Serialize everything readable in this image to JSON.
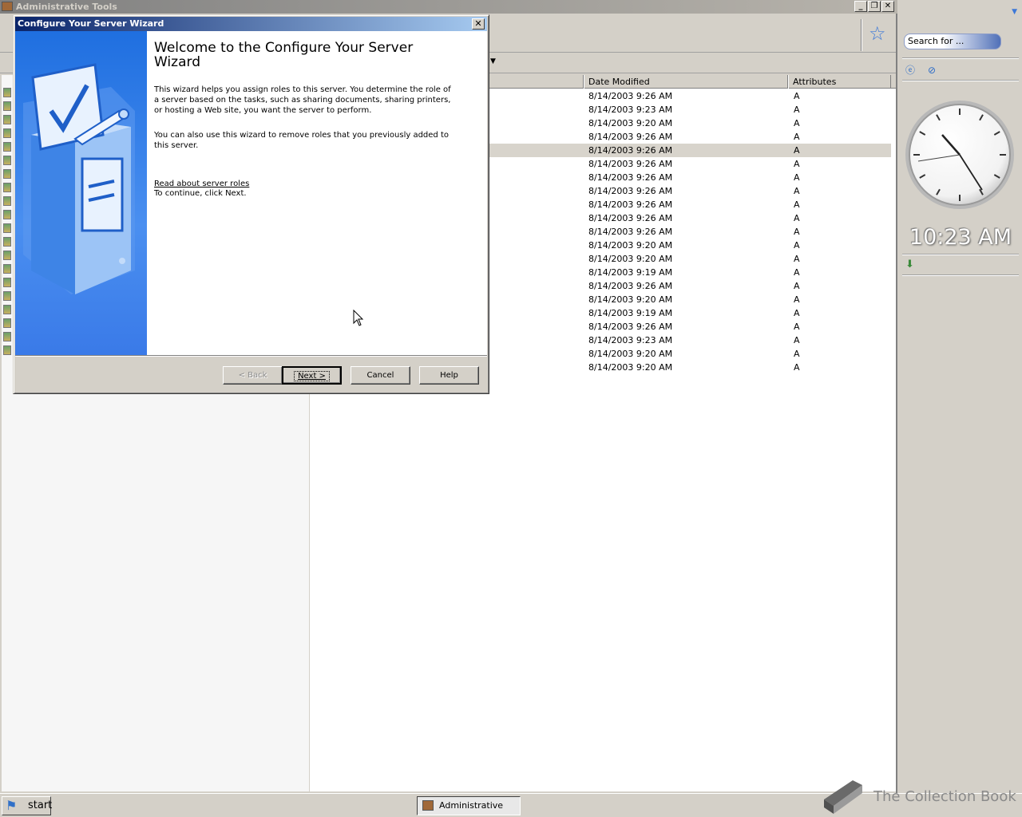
{
  "explorer": {
    "title": "Administrative Tools",
    "columns": {
      "date_modified": "Date Modified",
      "attributes": "Attributes"
    },
    "rows": [
      {
        "date": "8/14/2003 9:26 AM",
        "attr": "A"
      },
      {
        "date": "8/14/2003 9:23 AM",
        "attr": "A"
      },
      {
        "date": "8/14/2003 9:20 AM",
        "attr": "A"
      },
      {
        "date": "8/14/2003 9:26 AM",
        "attr": "A"
      },
      {
        "date": "8/14/2003 9:26 AM",
        "attr": "A",
        "selected": true
      },
      {
        "date": "8/14/2003 9:26 AM",
        "attr": "A"
      },
      {
        "date": "8/14/2003 9:26 AM",
        "attr": "A"
      },
      {
        "date": "8/14/2003 9:26 AM",
        "attr": "A"
      },
      {
        "date": "8/14/2003 9:26 AM",
        "attr": "A"
      },
      {
        "date": "8/14/2003 9:26 AM",
        "attr": "A"
      },
      {
        "date": "8/14/2003 9:26 AM",
        "attr": "A"
      },
      {
        "date": "8/14/2003 9:20 AM",
        "attr": "A"
      },
      {
        "date": "8/14/2003 9:20 AM",
        "attr": "A"
      },
      {
        "date": "8/14/2003 9:19 AM",
        "attr": "A"
      },
      {
        "date": "8/14/2003 9:26 AM",
        "attr": "A"
      },
      {
        "date": "8/14/2003 9:20 AM",
        "attr": "A"
      },
      {
        "date": "8/14/2003 9:19 AM",
        "attr": "A"
      },
      {
        "date": "8/14/2003 9:26 AM",
        "attr": "A"
      },
      {
        "date": "8/14/2003 9:23 AM",
        "attr": "A"
      },
      {
        "date": "8/14/2003 9:20 AM",
        "attr": "A"
      },
      {
        "date": "8/14/2003 9:20 AM",
        "attr": "A"
      }
    ]
  },
  "wizard": {
    "window_title": "Configure Your Server Wizard",
    "heading": "Welcome to the Configure Your Server Wizard",
    "paragraph1": "This wizard helps you assign roles to this server. You determine the role of a server based on the tasks, such as sharing documents, sharing printers, or hosting a Web site, you want the server to perform.",
    "paragraph2": "You can also use this wizard to remove roles that you previously added to this server.",
    "link": "Read about server roles",
    "continue_text": "To continue, click Next.",
    "buttons": {
      "back": "< Back",
      "next": "Next >",
      "cancel": "Cancel",
      "help": "Help"
    }
  },
  "sidebar": {
    "search_placeholder": "Search for ...",
    "clock_time": "10:23 AM"
  },
  "taskbar": {
    "start_label": "start",
    "task_admin": "Administrative Tool"
  },
  "watermark": {
    "text": "The Collection Book"
  },
  "colors": {
    "titlebar_active": "#0a246a",
    "titlebar_gradient_end": "#a6caf0",
    "banner_blue": "#1f6fe0",
    "face": "#d4d0c8"
  }
}
